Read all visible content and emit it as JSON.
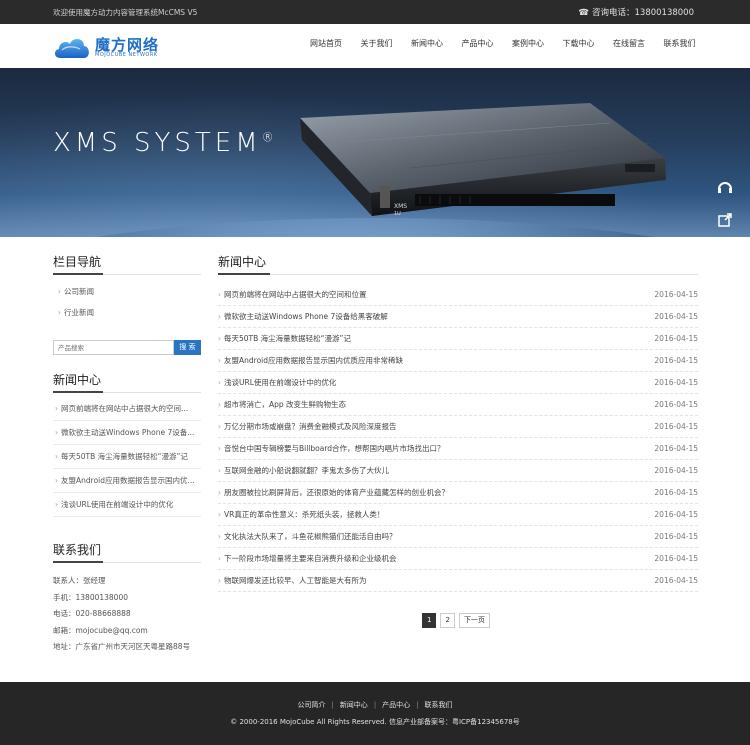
{
  "topbar": {
    "welcome": "欢迎使用魔方动力内容管理系统McCMS V5",
    "hotline": "咨询电话：13800138000",
    "phone_icon": "phone-icon"
  },
  "logo": {
    "cn": "魔方网络",
    "en": "MOJOCUBE NETWORK",
    "color": "#1f6fc7"
  },
  "nav": [
    "网站首页",
    "关于我们",
    "新闻中心",
    "产品中心",
    "案例中心",
    "下载中心",
    "在线留言",
    "联系我们"
  ],
  "banner": {
    "title": "XMS SYSTEM",
    "reg": "®",
    "server_label_1": "XMS",
    "server_label_2": "1U"
  },
  "float_icons": [
    "headset-icon",
    "share-icon",
    "qrcode-icon",
    "rocket-icon"
  ],
  "sidebar": {
    "category_title": "栏目导航",
    "categories": [
      "公司新闻",
      "行业新闻"
    ],
    "search_placeholder": "产品搜索",
    "search_button": "搜 索",
    "news_title": "新闻中心",
    "news": [
      "网页前端将在网站中占据很大的空间...",
      "微软欲主动送Windows Phone 7设备...",
      "每天50TB 海尘海量数据轻松“漫游”记",
      "友盟Android应用数据报告显示国内优...",
      "浅谈URL使用在前端设计中的优化"
    ],
    "contact_title": "联系我们",
    "contact": [
      "联系人：张经理",
      "手机：13800138000",
      "电话：020-88668888",
      "邮箱：mojocube@qq.com",
      "地址：广东省广州市天河区天粤星路88号"
    ]
  },
  "main": {
    "title": "新闻中心",
    "articles": [
      {
        "title": "网页前端将在网站中占据很大的空间和位置",
        "date": "2016-04-15"
      },
      {
        "title": "微软欲主动送Windows Phone 7设备给黑客破解",
        "date": "2016-04-15"
      },
      {
        "title": "每天50TB 海尘海量数据轻松“漫游”记",
        "date": "2016-04-15"
      },
      {
        "title": "友盟Android应用数据报告显示国内优质应用非常稀缺",
        "date": "2016-04-15"
      },
      {
        "title": "浅谈URL使用在前端设计中的优化",
        "date": "2016-04-15"
      },
      {
        "title": "超市将消亡，App 改变生鲜购物生态",
        "date": "2016-04-15"
      },
      {
        "title": "万亿分期市场或崩盘？消费金融模式及风险深度报告",
        "date": "2016-04-15"
      },
      {
        "title": "音悦台中国专辑榜要与Billboard合作，想帮国内唱片市场找出口？",
        "date": "2016-04-15"
      },
      {
        "title": "互联网金融的小船说翻就翻？李鬼太多伤了大伙儿",
        "date": "2016-04-15"
      },
      {
        "title": "朋友圈被拉比刷屏背后，还很原始的体育产业蕴藏怎样的创业机会？",
        "date": "2016-04-15"
      },
      {
        "title": "VR真正的革命性意义：杀死纸头装，拯救人类！",
        "date": "2016-04-15"
      },
      {
        "title": "文化执法大队来了，斗鱼花椒熊猫们还能活自由吗？",
        "date": "2016-04-15"
      },
      {
        "title": "下一阶段市场增量将主要来自消费升级和企业级机会",
        "date": "2016-04-15"
      },
      {
        "title": "物联网爆发还比较早、人工智能是大有所为",
        "date": "2016-04-15"
      }
    ],
    "pager": [
      "1",
      "2",
      "下一页"
    ]
  },
  "footer": {
    "links": [
      "公司简介",
      "新闻中心",
      "产品中心",
      "联系我们"
    ],
    "copyright": "© 2000-2016 MojoCube All Rights Reserved. 信息产业部备案号：粤ICP备12345678号"
  }
}
